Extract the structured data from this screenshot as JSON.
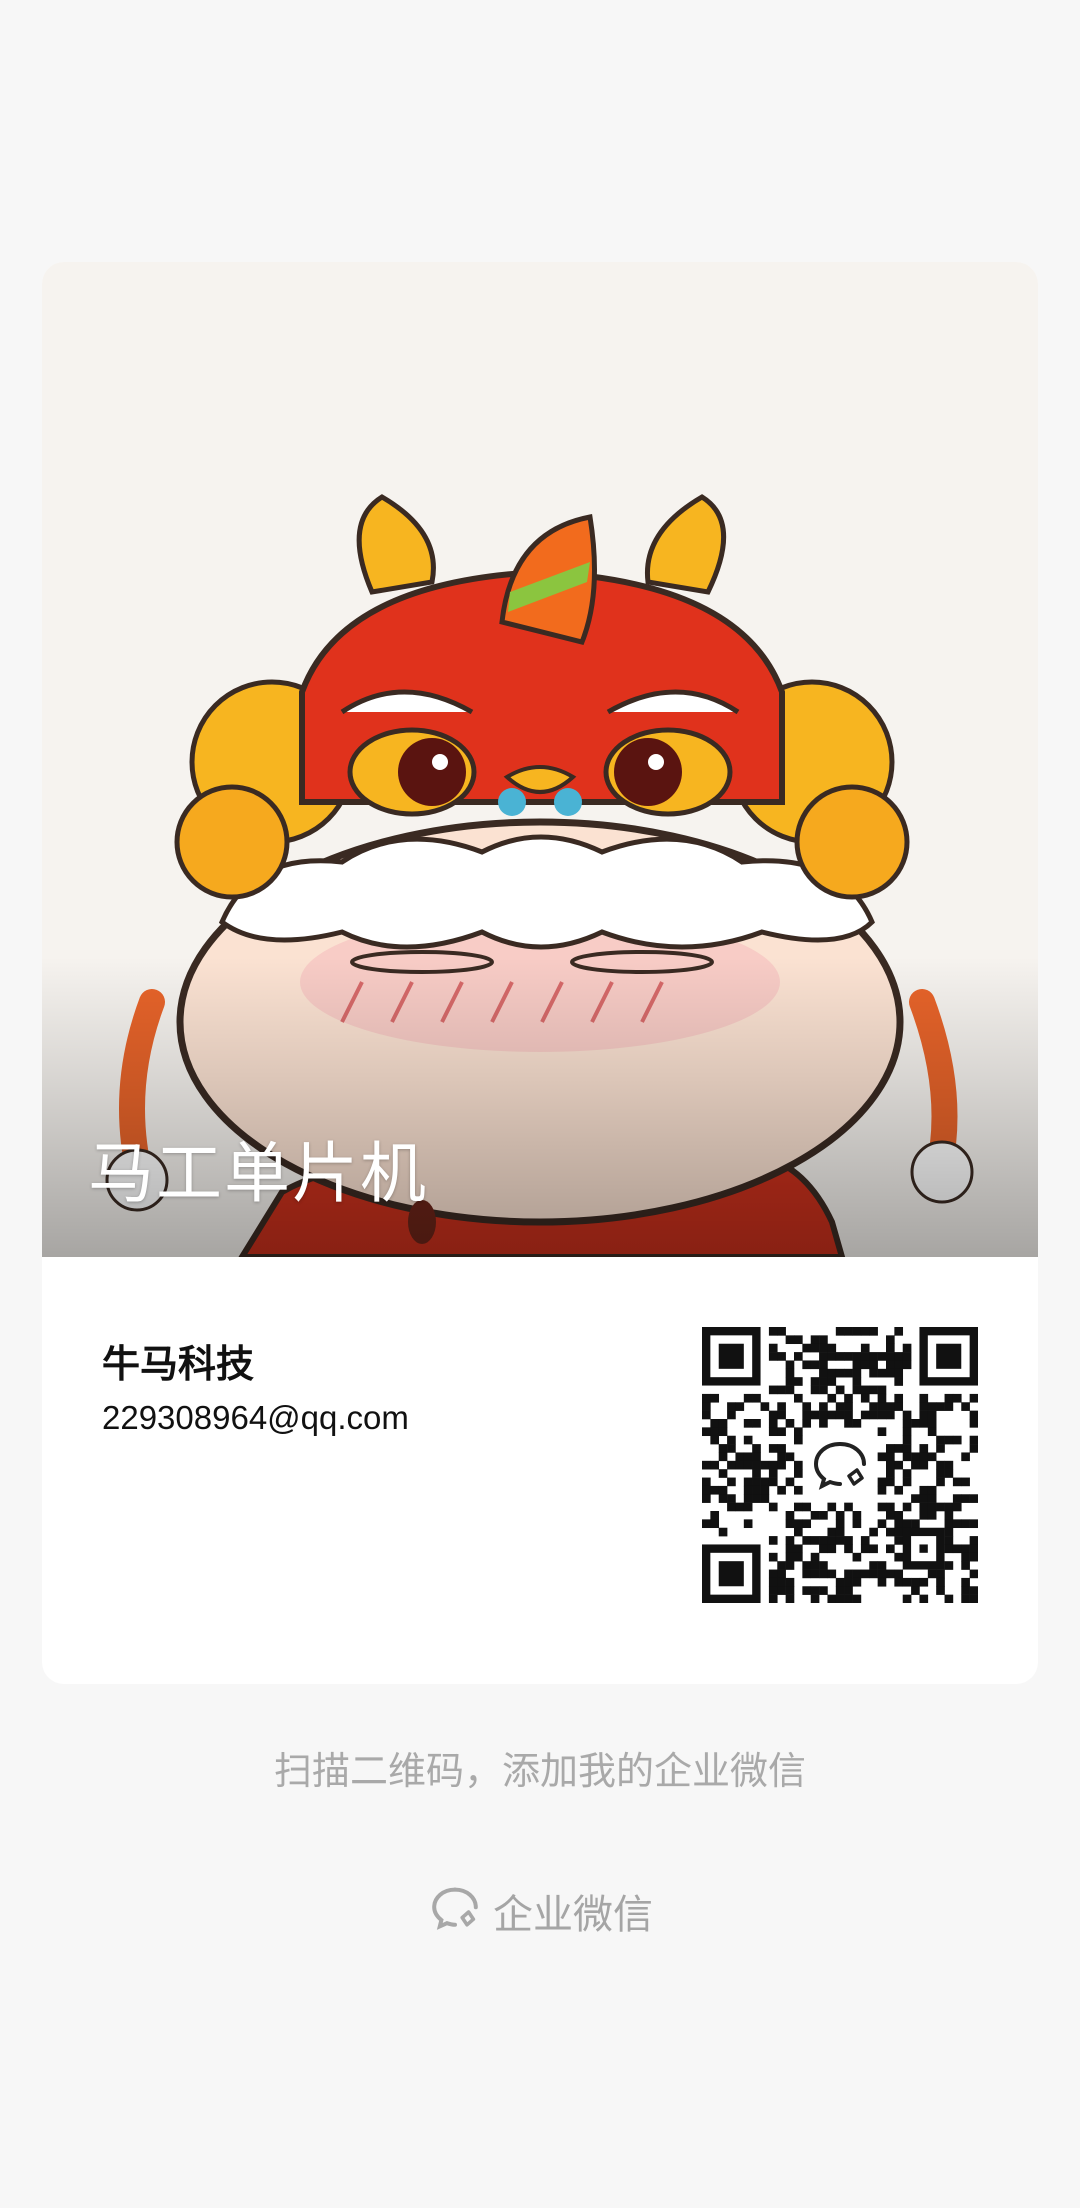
{
  "card": {
    "cover_title": "马工单片机",
    "cover_image": "lion-dance-cartoon-illustration",
    "company_name": "牛马科技",
    "email": "229308964@qq.com",
    "qr_icon": "wecom-logo-icon"
  },
  "footer": {
    "hint": "扫描二维码，添加我的企业微信",
    "brand_label": "企业微信",
    "brand_icon": "wecom-logo-icon"
  },
  "colors": {
    "background": "#f7f7f7",
    "card": "#ffffff",
    "muted_text": "#a9a9a9",
    "title_text": "#111111"
  }
}
